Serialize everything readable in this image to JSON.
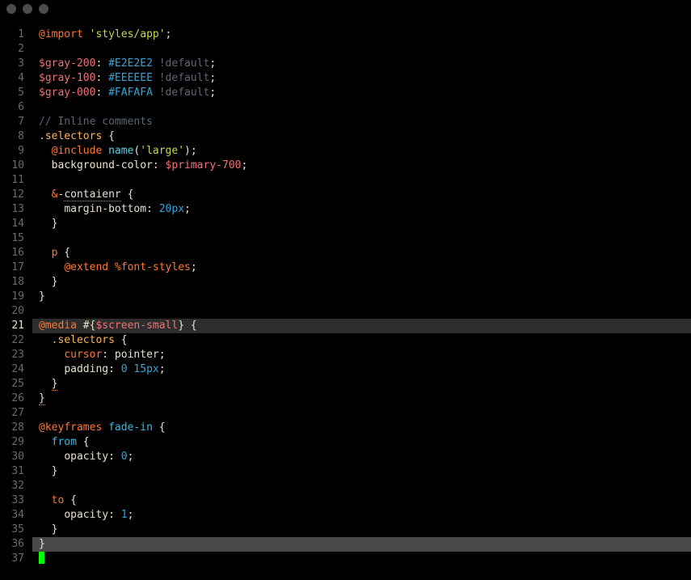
{
  "current_line": 21,
  "selection_line": 36,
  "cursor_line": 37,
  "lines": [
    {
      "n": 1,
      "indent": 0,
      "tokens": [
        {
          "cls": "t-orange",
          "t": "@import"
        },
        {
          "cls": "t-white",
          "t": " "
        },
        {
          "cls": "t-green",
          "t": "'styles/app'"
        },
        {
          "cls": "t-white",
          "t": ";"
        }
      ]
    },
    {
      "n": 2,
      "indent": 0,
      "tokens": []
    },
    {
      "n": 3,
      "indent": 0,
      "tokens": [
        {
          "cls": "t-red",
          "t": "$gray-200"
        },
        {
          "cls": "t-white",
          "t": ": "
        },
        {
          "cls": "t-teal",
          "t": "#E2E2E2"
        },
        {
          "cls": "t-white",
          "t": " "
        },
        {
          "cls": "t-gray",
          "t": "!default"
        },
        {
          "cls": "t-white",
          "t": ";"
        }
      ]
    },
    {
      "n": 4,
      "indent": 0,
      "tokens": [
        {
          "cls": "t-red",
          "t": "$gray-100"
        },
        {
          "cls": "t-white",
          "t": ": "
        },
        {
          "cls": "t-teal",
          "t": "#EEEEEE"
        },
        {
          "cls": "t-white",
          "t": " "
        },
        {
          "cls": "t-gray",
          "t": "!default"
        },
        {
          "cls": "t-white",
          "t": ";"
        }
      ]
    },
    {
      "n": 5,
      "indent": 0,
      "tokens": [
        {
          "cls": "t-red",
          "t": "$gray-000"
        },
        {
          "cls": "t-white",
          "t": ": "
        },
        {
          "cls": "t-teal",
          "t": "#FAFAFA"
        },
        {
          "cls": "t-white",
          "t": " "
        },
        {
          "cls": "t-gray",
          "t": "!default"
        },
        {
          "cls": "t-white",
          "t": ";"
        }
      ]
    },
    {
      "n": 6,
      "indent": 0,
      "tokens": []
    },
    {
      "n": 7,
      "indent": 0,
      "tokens": [
        {
          "cls": "t-gray",
          "t": "// Inline comments"
        }
      ]
    },
    {
      "n": 8,
      "indent": 0,
      "tokens": [
        {
          "cls": "t-yellow",
          "t": ".selectors"
        },
        {
          "cls": "t-white",
          "t": " {"
        }
      ]
    },
    {
      "n": 9,
      "indent": 1,
      "tokens": [
        {
          "cls": "t-orange",
          "t": "@include"
        },
        {
          "cls": "t-white",
          "t": " "
        },
        {
          "cls": "t-cyanfunc",
          "t": "name"
        },
        {
          "cls": "t-white",
          "t": "("
        },
        {
          "cls": "t-green",
          "t": "'large'"
        },
        {
          "cls": "t-white",
          "t": ");"
        }
      ]
    },
    {
      "n": 10,
      "indent": 1,
      "tokens": [
        {
          "cls": "t-white",
          "t": "background-color: "
        },
        {
          "cls": "t-red",
          "t": "$primary-700"
        },
        {
          "cls": "t-white",
          "t": ";"
        }
      ]
    },
    {
      "n": 11,
      "indent": 0,
      "tokens": []
    },
    {
      "n": 12,
      "indent": 1,
      "tokens": [
        {
          "cls": "t-orange",
          "t": "&"
        },
        {
          "cls": "t-white",
          "t": "-"
        },
        {
          "cls": "t-white underline-squiggle",
          "t": "contaienr"
        },
        {
          "cls": "t-white",
          "t": " {"
        }
      ]
    },
    {
      "n": 13,
      "indent": 2,
      "tokens": [
        {
          "cls": "t-white",
          "t": "margin-bottom: "
        },
        {
          "cls": "t-teal",
          "t": "20px"
        },
        {
          "cls": "t-white",
          "t": ";"
        }
      ]
    },
    {
      "n": 14,
      "indent": 1,
      "tokens": [
        {
          "cls": "t-white",
          "t": "}"
        }
      ]
    },
    {
      "n": 15,
      "indent": 0,
      "tokens": []
    },
    {
      "n": 16,
      "indent": 1,
      "tokens": [
        {
          "cls": "t-orange",
          "t": "p"
        },
        {
          "cls": "t-white",
          "t": " {"
        }
      ]
    },
    {
      "n": 17,
      "indent": 2,
      "tokens": [
        {
          "cls": "t-orange",
          "t": "@extend"
        },
        {
          "cls": "t-white",
          "t": " "
        },
        {
          "cls": "t-orange",
          "t": "%font-styles"
        },
        {
          "cls": "t-white",
          "t": ";"
        }
      ]
    },
    {
      "n": 18,
      "indent": 1,
      "tokens": [
        {
          "cls": "t-white",
          "t": "}"
        }
      ]
    },
    {
      "n": 19,
      "indent": 0,
      "tokens": [
        {
          "cls": "t-white",
          "t": "}"
        }
      ]
    },
    {
      "n": 20,
      "indent": 0,
      "tokens": []
    },
    {
      "n": 21,
      "indent": 0,
      "hl": "linehl",
      "tokens": [
        {
          "cls": "t-orange",
          "t": "@media"
        },
        {
          "cls": "t-white",
          "t": " #{"
        },
        {
          "cls": "t-red",
          "t": "$screen-small"
        },
        {
          "cls": "t-white",
          "t": "} {"
        }
      ]
    },
    {
      "n": 22,
      "indent": 1,
      "tokens": [
        {
          "cls": "t-yellow",
          "t": ".selectors"
        },
        {
          "cls": "t-white",
          "t": " {"
        }
      ]
    },
    {
      "n": 23,
      "indent": 2,
      "tokens": [
        {
          "cls": "t-orange",
          "t": "cursor"
        },
        {
          "cls": "t-white",
          "t": ": pointer;"
        }
      ]
    },
    {
      "n": 24,
      "indent": 2,
      "tokens": [
        {
          "cls": "t-white",
          "t": "padding: "
        },
        {
          "cls": "t-teal",
          "t": "0"
        },
        {
          "cls": "t-white",
          "t": " "
        },
        {
          "cls": "t-teal",
          "t": "15px"
        },
        {
          "cls": "t-white",
          "t": ";"
        }
      ]
    },
    {
      "n": 25,
      "indent": 1,
      "tokens": [
        {
          "cls": "t-white underline-squiggle",
          "t": "}"
        }
      ]
    },
    {
      "n": 26,
      "indent": 0,
      "tokens": [
        {
          "cls": "t-white underline-squiggle",
          "t": "}"
        }
      ]
    },
    {
      "n": 27,
      "indent": 0,
      "tokens": []
    },
    {
      "n": 28,
      "indent": 0,
      "tokens": [
        {
          "cls": "t-orange",
          "t": "@keyframes"
        },
        {
          "cls": "t-white",
          "t": " "
        },
        {
          "cls": "t-blue",
          "t": "fade-in"
        },
        {
          "cls": "t-white",
          "t": " {"
        }
      ]
    },
    {
      "n": 29,
      "indent": 1,
      "tokens": [
        {
          "cls": "t-blue",
          "t": "from"
        },
        {
          "cls": "t-white",
          "t": " {"
        }
      ]
    },
    {
      "n": 30,
      "indent": 2,
      "tokens": [
        {
          "cls": "t-white",
          "t": "opacity: "
        },
        {
          "cls": "t-teal",
          "t": "0"
        },
        {
          "cls": "t-white",
          "t": ";"
        }
      ]
    },
    {
      "n": 31,
      "indent": 1,
      "tokens": [
        {
          "cls": "t-white",
          "t": "}"
        }
      ]
    },
    {
      "n": 32,
      "indent": 0,
      "tokens": []
    },
    {
      "n": 33,
      "indent": 1,
      "tokens": [
        {
          "cls": "t-orange",
          "t": "to"
        },
        {
          "cls": "t-white",
          "t": " {"
        }
      ]
    },
    {
      "n": 34,
      "indent": 2,
      "tokens": [
        {
          "cls": "t-white",
          "t": "opacity: "
        },
        {
          "cls": "t-teal",
          "t": "1"
        },
        {
          "cls": "t-white",
          "t": ";"
        }
      ]
    },
    {
      "n": 35,
      "indent": 1,
      "tokens": [
        {
          "cls": "t-white",
          "t": "}"
        }
      ]
    },
    {
      "n": 36,
      "indent": 0,
      "hl": "sel36",
      "tokens": [
        {
          "cls": "t-white",
          "t": "}"
        }
      ]
    },
    {
      "n": 37,
      "indent": 0,
      "cursor": true,
      "tokens": []
    }
  ]
}
